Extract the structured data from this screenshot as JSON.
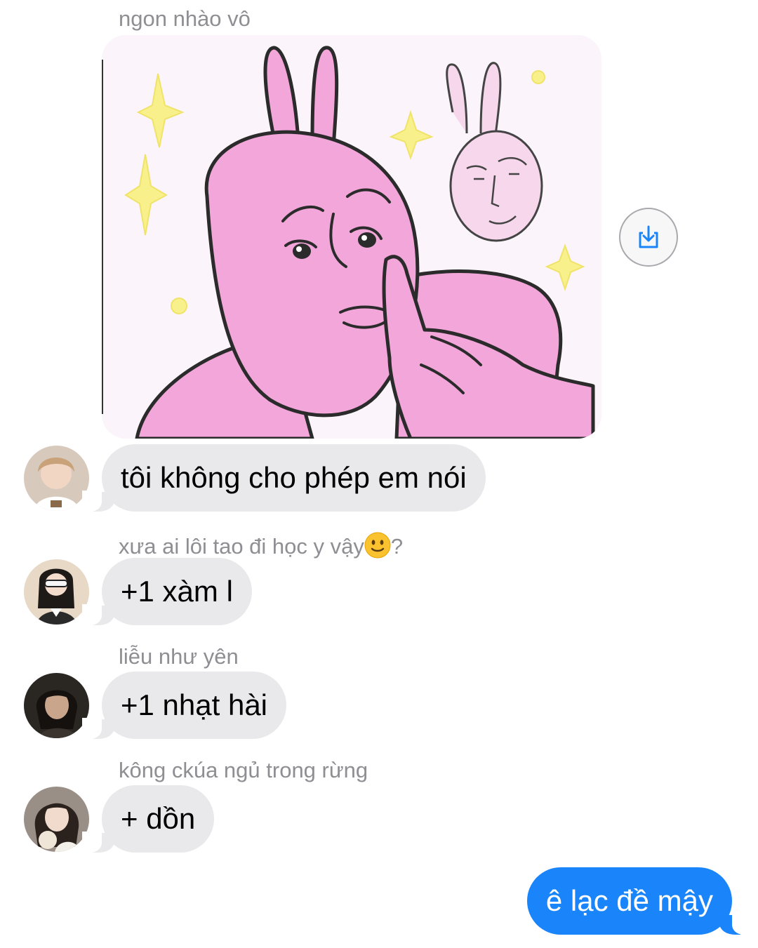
{
  "messages": [
    {
      "sender": "ngon nhào vô",
      "type": "sticker",
      "sticker_icon": "pink-rabbit-shush-sticker",
      "action_icon": "save-to-photos-icon"
    },
    {
      "sender": "",
      "type": "text",
      "text": "tôi không cho phép em nói"
    },
    {
      "sender": "xưa ai lôi tao đi học y vậy",
      "sender_emoji": "slightly-smiling-face",
      "sender_suffix": "?",
      "type": "text",
      "text": "+1 xàm l"
    },
    {
      "sender": "liễu như yên",
      "type": "text",
      "text": "+1 nhạt hài"
    },
    {
      "sender": "kông ckúa ngủ trong rừng",
      "type": "text",
      "text": "+ dồn"
    }
  ],
  "outgoing": {
    "text": "ê lạc đề mậy"
  },
  "colors": {
    "incoming_bubble": "#e9e9eb",
    "outgoing_bubble": "#1a84fb",
    "sender_name": "#8e8e93",
    "sticker_pink": "#f3a6d9"
  }
}
